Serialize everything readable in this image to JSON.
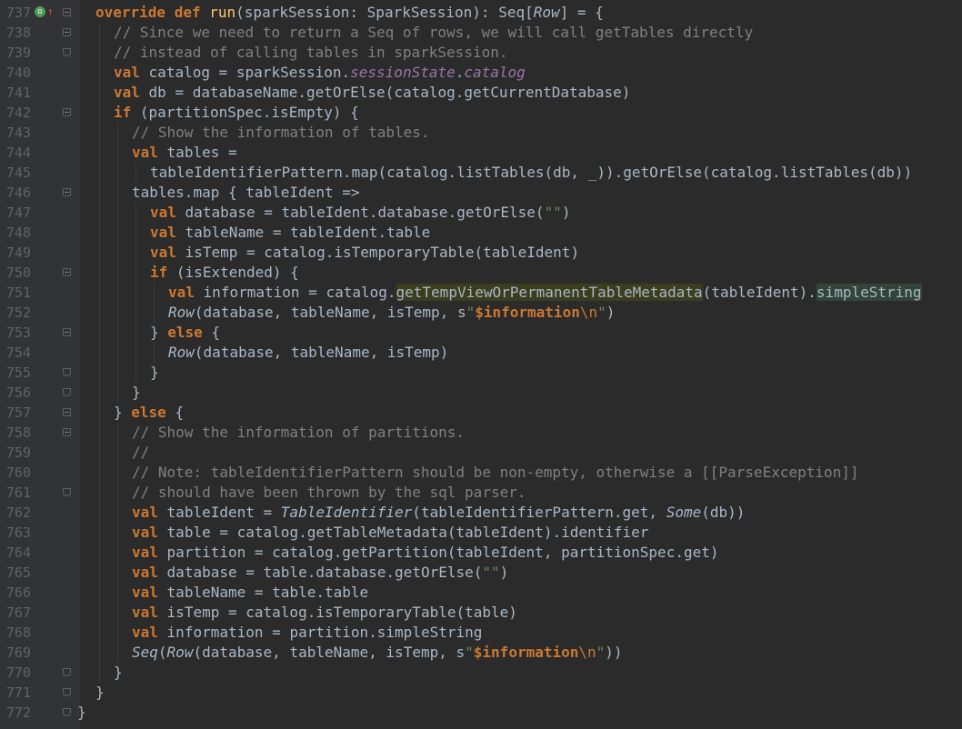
{
  "editor": {
    "lines": [
      {
        "num": "737",
        "text": "override def run(sparkSession: SparkSession): Seq[Row] = {",
        "indent": 0,
        "fold": "open",
        "icon": true
      },
      {
        "num": "738",
        "text": "// Since we need to return a Seq of rows, we will call getTables directly",
        "indent": 1,
        "fold": "open"
      },
      {
        "num": "739",
        "text": "// instead of calling tables in sparkSession.",
        "indent": 1,
        "fold": "end"
      },
      {
        "num": "740",
        "text": "val catalog = sparkSession.sessionState.catalog",
        "indent": 1
      },
      {
        "num": "741",
        "text": "val db = databaseName.getOrElse(catalog.getCurrentDatabase)",
        "indent": 1
      },
      {
        "num": "742",
        "text": "if (partitionSpec.isEmpty) {",
        "indent": 1,
        "fold": "open"
      },
      {
        "num": "743",
        "text": "// Show the information of tables.",
        "indent": 2
      },
      {
        "num": "744",
        "text": "val tables =",
        "indent": 2
      },
      {
        "num": "745",
        "text": "tableIdentifierPattern.map(catalog.listTables(db, _)).getOrElse(catalog.listTables(db))",
        "indent": 3
      },
      {
        "num": "746",
        "text": "tables.map { tableIdent =>",
        "indent": 2,
        "fold": "open"
      },
      {
        "num": "747",
        "text": "val database = tableIdent.database.getOrElse(\"\")",
        "indent": 3
      },
      {
        "num": "748",
        "text": "val tableName = tableIdent.table",
        "indent": 3
      },
      {
        "num": "749",
        "text": "val isTemp = catalog.isTemporaryTable(tableIdent)",
        "indent": 3
      },
      {
        "num": "750",
        "text": "if (isExtended) {",
        "indent": 3,
        "fold": "open"
      },
      {
        "num": "751",
        "text": "val information = catalog.getTempViewOrPermanentTableMetadata(tableIdent).simpleString",
        "indent": 4
      },
      {
        "num": "752",
        "text": "Row(database, tableName, isTemp, s\"$information\\n\")",
        "indent": 4
      },
      {
        "num": "753",
        "text": "} else {",
        "indent": 3,
        "fold": "open"
      },
      {
        "num": "754",
        "text": "Row(database, tableName, isTemp)",
        "indent": 4
      },
      {
        "num": "755",
        "text": "}",
        "indent": 3,
        "fold": "end"
      },
      {
        "num": "756",
        "text": "}",
        "indent": 2,
        "fold": "end"
      },
      {
        "num": "757",
        "text": "} else {",
        "indent": 1,
        "fold": "open"
      },
      {
        "num": "758",
        "text": "// Show the information of partitions.",
        "indent": 2,
        "fold": "open"
      },
      {
        "num": "759",
        "text": "//",
        "indent": 2
      },
      {
        "num": "760",
        "text": "// Note: tableIdentifierPattern should be non-empty, otherwise a [[ParseException]]",
        "indent": 2
      },
      {
        "num": "761",
        "text": "// should have been thrown by the sql parser.",
        "indent": 2,
        "fold": "end"
      },
      {
        "num": "762",
        "text": "val tableIdent = TableIdentifier(tableIdentifierPattern.get, Some(db))",
        "indent": 2
      },
      {
        "num": "763",
        "text": "val table = catalog.getTableMetadata(tableIdent).identifier",
        "indent": 2
      },
      {
        "num": "764",
        "text": "val partition = catalog.getPartition(tableIdent, partitionSpec.get)",
        "indent": 2
      },
      {
        "num": "765",
        "text": "val database = table.database.getOrElse(\"\")",
        "indent": 2
      },
      {
        "num": "766",
        "text": "val tableName = table.table",
        "indent": 2
      },
      {
        "num": "767",
        "text": "val isTemp = catalog.isTemporaryTable(table)",
        "indent": 2
      },
      {
        "num": "768",
        "text": "val information = partition.simpleString",
        "indent": 2
      },
      {
        "num": "769",
        "text": "Seq(Row(database, tableName, isTemp, s\"$information\\n\"))",
        "indent": 2
      },
      {
        "num": "770",
        "text": "}",
        "indent": 1,
        "fold": "end"
      },
      {
        "num": "771",
        "text": "}",
        "indent": 0,
        "fold": "end"
      },
      {
        "num": "772",
        "text": "}",
        "indent": -1,
        "fold": "end"
      }
    ]
  },
  "colors": {
    "background": "#2b2b2b",
    "gutter": "#313335",
    "keyword": "#cc7832",
    "function": "#ffc66d",
    "comment": "#808080",
    "string": "#6a8759",
    "field": "#9876aa",
    "text": "#a9b7c6"
  },
  "icons": {
    "override": "override-method-icon",
    "implemented": "implemented-arrow-icon"
  }
}
